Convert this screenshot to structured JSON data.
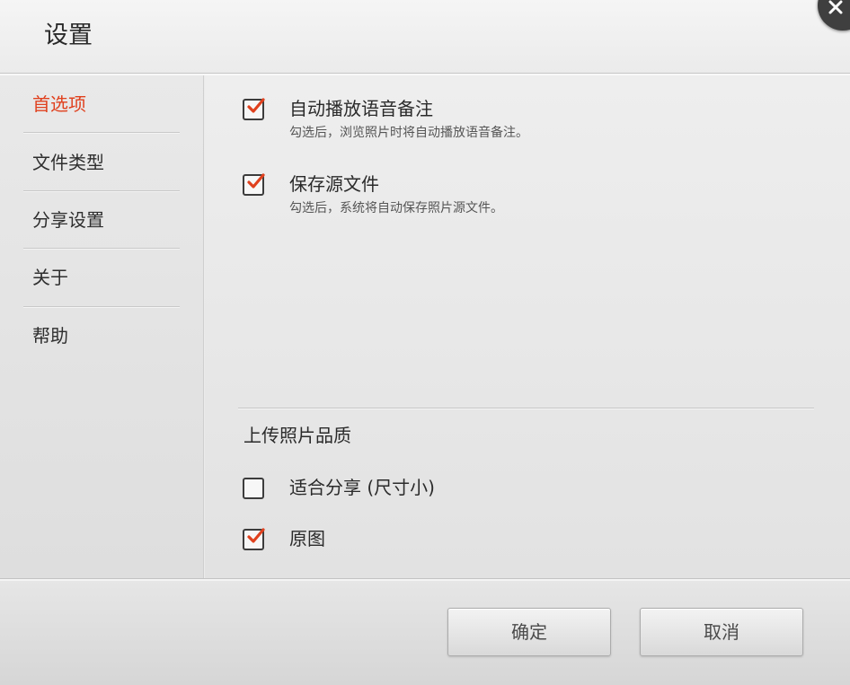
{
  "dialog": {
    "title": "设置",
    "close_icon": "close-icon"
  },
  "sidebar": {
    "items": [
      {
        "label": "首选项",
        "active": true
      },
      {
        "label": "文件类型",
        "active": false
      },
      {
        "label": "分享设置",
        "active": false
      },
      {
        "label": "关于",
        "active": false
      },
      {
        "label": "帮助",
        "active": false
      }
    ]
  },
  "preferences": {
    "options": [
      {
        "title": "自动播放语音备注",
        "description": "勾选后，浏览照片时将自动播放语音备注。",
        "checked": true
      },
      {
        "title": "保存源文件",
        "description": "勾选后，系统将自动保存照片源文件。",
        "checked": true
      }
    ],
    "quality": {
      "title": "上传照片品质",
      "options": [
        {
          "label": "适合分享 (尺寸小)",
          "checked": false
        },
        {
          "label": "原图",
          "checked": true
        }
      ]
    }
  },
  "footer": {
    "ok_label": "确定",
    "cancel_label": "取消"
  },
  "colors": {
    "accent": "#e0411e",
    "check": "#e0411e"
  }
}
